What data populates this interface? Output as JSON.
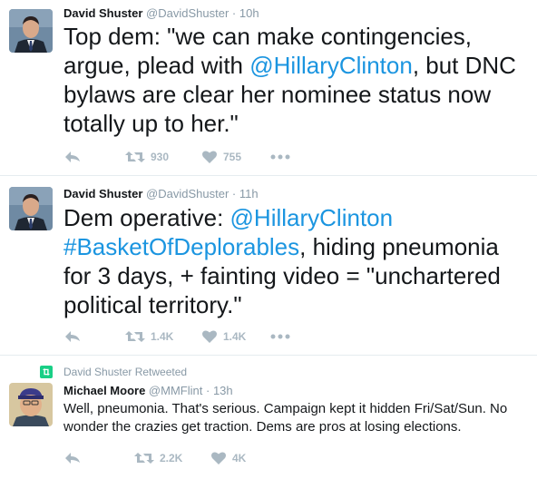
{
  "tweets": [
    {
      "name": "David Shuster",
      "handle": "@DavidShuster",
      "sep": "·",
      "time": "10h",
      "text_parts": [
        "Top dem: \"we can make contingencies, argue, plead with ",
        "@HillaryClinton",
        ", but DNC bylaws are clear her nominee status now totally up to her.\""
      ],
      "retweets": "930",
      "likes": "755",
      "icons": [
        "reply-icon",
        "retweet-icon",
        "like-icon",
        "more-icon"
      ]
    },
    {
      "name": "David Shuster",
      "handle": "@DavidShuster",
      "sep": "·",
      "time": "11h",
      "text_parts": [
        "Dem operative:  ",
        "@HillaryClinton",
        " ",
        "#BasketOfDeplorables",
        ", hiding pneumonia for 3 days, + fainting video = \"unchartered political territory.\""
      ],
      "retweets": "1.4K",
      "likes": "1.4K",
      "icons": [
        "reply-icon",
        "retweet-icon",
        "like-icon",
        "more-icon"
      ]
    },
    {
      "retweet_note": "David Shuster Retweeted",
      "name": "Michael Moore",
      "handle": "@MMFlint",
      "sep": "·",
      "time": "13h",
      "text": "Well, pneumonia. That's serious. Campaign kept it hidden Fri/Sat/Sun. No wonder the crazies get traction. Dems are pros at losing elections.",
      "retweets": "2.2K",
      "likes": "4K",
      "icons": [
        "reply-icon",
        "retweet-icon",
        "like-icon"
      ]
    }
  ],
  "colors": {
    "link": "#1b95e0",
    "icon": "#aab8c2",
    "secondary_text": "#8899a6",
    "retweet_badge": "#19cf86",
    "divider": "#e6ecf0"
  }
}
